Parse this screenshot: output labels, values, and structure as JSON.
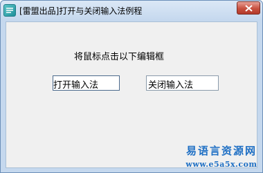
{
  "window": {
    "title": "[雷盟出品]打开与关闭输入法例程"
  },
  "main": {
    "hint": "将鼠标点击以下编辑框",
    "edit_open_value": "打开输入法",
    "edit_close_value": "关闭输入法"
  },
  "watermark": {
    "name": "易语言资源网",
    "url": "www.e5a5x.com"
  },
  "icons": {
    "app": "app-icon",
    "close": "close-icon"
  }
}
